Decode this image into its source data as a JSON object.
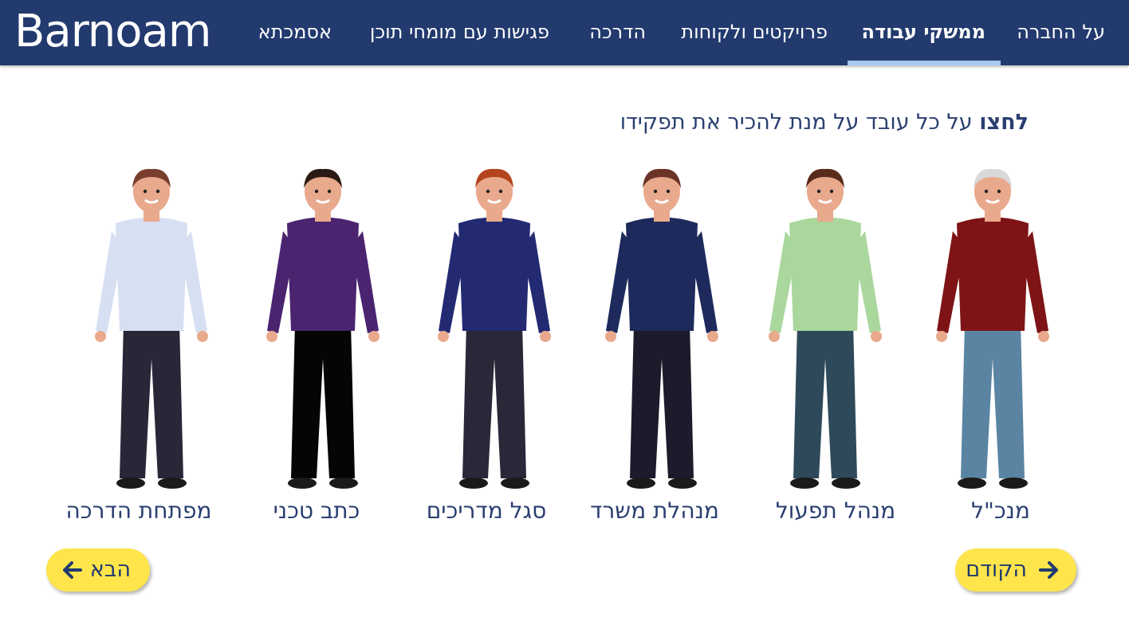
{
  "header": {
    "logo_text": "Barnoam",
    "nav": [
      {
        "label": "על החברה",
        "active": false
      },
      {
        "label": "ממשקי עבודה",
        "active": true
      },
      {
        "label": "פרויקטים ולקוחות",
        "active": false
      },
      {
        "label": "הדרכה",
        "active": false
      },
      {
        "label": "פגישות עם מומחי תוכן",
        "active": false
      },
      {
        "label": "אסמכתא",
        "active": false
      }
    ]
  },
  "main": {
    "instruction_bold": "לחצו",
    "instruction_rest": " על כל עובד על מנת להכיר את תפקידו",
    "people": [
      {
        "role": "מנכ\"ל",
        "shirt": "#7e1416",
        "pants": "#5a84a2",
        "hair": "#d9d9d9"
      },
      {
        "role": "מנהל תפעול",
        "shirt": "#a9d79c",
        "pants": "#2e4a5a",
        "hair": "#5a2a1a"
      },
      {
        "role": "מנהלת משרד",
        "shirt": "#1e2a5c",
        "pants": "#1b1b2b",
        "hair": "#6a3426"
      },
      {
        "role": "סגל מדריכים",
        "shirt": "#232a72",
        "pants": "#2a2738",
        "hair": "#b4441e"
      },
      {
        "role": "כתב טכני",
        "shirt": "#4b2470",
        "pants": "#050505",
        "hair": "#2a1a14"
      },
      {
        "role": "מפתחת הדרכה",
        "shirt": "#d7e0f3",
        "pants": "#2a2638",
        "hair": "#7a3e2e"
      }
    ],
    "prev_label": "הקודם",
    "next_label": "הבא"
  },
  "colors": {
    "topbar": "#223a6e",
    "accent_button": "#fde54b",
    "text": "#2a3f70",
    "nav_underline": "#a9c8f0"
  }
}
